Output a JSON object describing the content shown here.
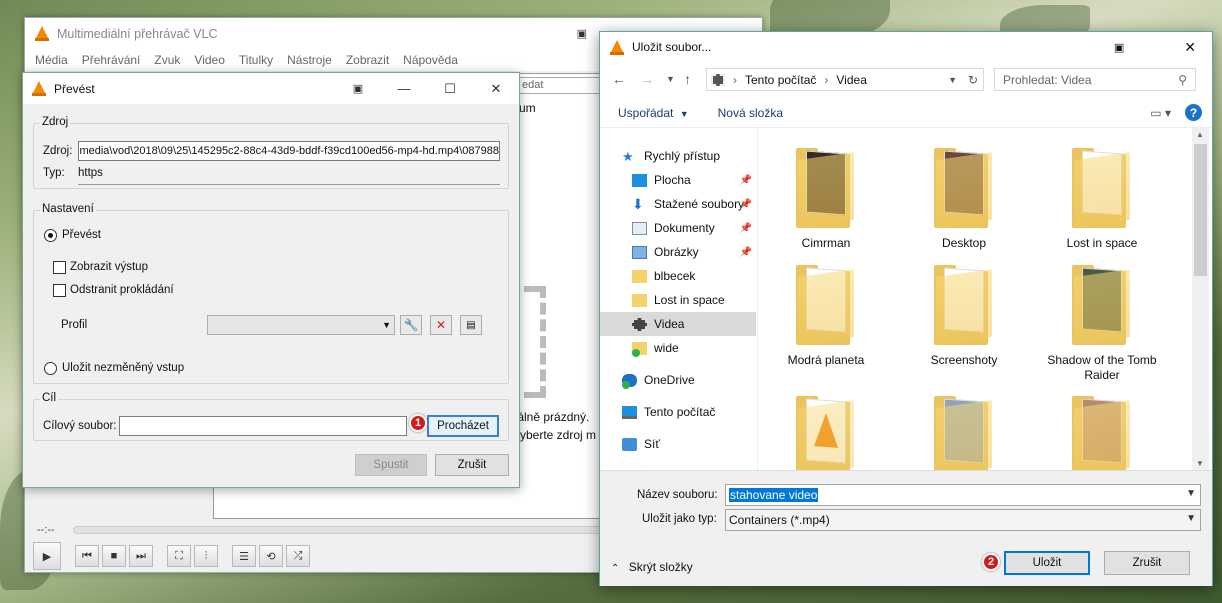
{
  "vlc_main": {
    "title": "Multimediální přehrávač VLC",
    "menu": [
      "Média",
      "Přehrávání",
      "Zvuk",
      "Video",
      "Titulky",
      "Nástroje",
      "Zobrazit",
      "Nápověda"
    ],
    "playlist_search_placeholder": "edat",
    "playlist_partial_text": "um",
    "empty_line1": "tálně prázdný.",
    "empty_line2": "vyberte zdroj m",
    "time": "--:--"
  },
  "convert": {
    "title": "Převést",
    "source_group": "Zdroj",
    "source_label": "Zdroj:",
    "source_value": "087988\\media\\vod\\2018\\09\\25\\145295c2-88c4-43d9-bddf-f39cd100ed56-mp4-hd.mp4",
    "type_label": "Typ:",
    "type_value": "https",
    "settings_group": "Nastavení",
    "convert_radio": "Převést",
    "show_output": "Zobrazit výstup",
    "deinterlace": "Odstranit prokládání",
    "profile_label": "Profil",
    "dump_raw": "Uložit nezměněný vstup",
    "dest_group": "Cíl",
    "dest_label": "Cílový soubor:",
    "browse_button": "Procházet",
    "start_button": "Spustit",
    "cancel_button": "Zrušit",
    "badge1": "1"
  },
  "save_dialog": {
    "title": "Uložit soubor...",
    "breadcrumb": [
      "Tento počítač",
      "Videa"
    ],
    "search_placeholder": "Prohledat: Videa",
    "organize": "Uspořádat",
    "new_folder": "Nová složka",
    "nav": [
      {
        "label": "Rychlý přístup",
        "icon": "star-icon"
      },
      {
        "label": "Plocha",
        "icon": "desktop-icon",
        "pinned": true
      },
      {
        "label": "Stažené soubory",
        "icon": "download-icon",
        "pinned": true
      },
      {
        "label": "Dokumenty",
        "icon": "documents-icon",
        "pinned": true
      },
      {
        "label": "Obrázky",
        "icon": "pictures-icon",
        "pinned": true
      },
      {
        "label": "blbecek",
        "icon": "folder-icon"
      },
      {
        "label": "Lost in space",
        "icon": "folder-icon"
      },
      {
        "label": "Videa",
        "icon": "videos-icon"
      },
      {
        "label": "wide",
        "icon": "folder-sync-icon"
      },
      {
        "label": "OneDrive",
        "icon": "onedrive-icon"
      },
      {
        "label": "Tento počítač",
        "icon": "computer-icon"
      },
      {
        "label": "Síť",
        "icon": "network-icon"
      }
    ],
    "folders": [
      {
        "name": "Cimrman",
        "color": "#3a2a20"
      },
      {
        "name": "Desktop",
        "color": "#6b4a3a"
      },
      {
        "name": "Lost in space",
        "color": "#ffffff"
      },
      {
        "name": "Modrá planeta",
        "color": "#ffffff"
      },
      {
        "name": "Screenshoty",
        "color": "#ffffff"
      },
      {
        "name": "Shadow of the Tomb Raider",
        "color": "#4b5a40"
      },
      {
        "name": "",
        "color": "#f07a00"
      },
      {
        "name": "",
        "color": "#8fa4b8"
      },
      {
        "name": "",
        "color": "#b88a70"
      }
    ],
    "filename_label": "Název souboru:",
    "filename_value": "stahovane video",
    "filetype_label": "Uložit jako typ:",
    "filetype_value": "Containers (*.mp4)",
    "hide_folders": "Skrýt složky",
    "save_button": "Uložit",
    "cancel_button": "Zrušit",
    "badge2": "2"
  }
}
